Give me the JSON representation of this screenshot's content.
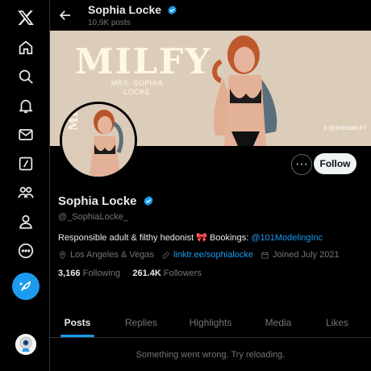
{
  "header": {
    "name": "Sophia Locke",
    "posts_count": "10,9K posts"
  },
  "banner": {
    "brand": "MILFY",
    "subtitle_line1": "MRS. SOPHIA",
    "subtitle_line2": "LOCKE",
    "handle": "X @SHESMILFY"
  },
  "profile_pic": {
    "brand": "MILFY"
  },
  "actions": {
    "follow_label": "Follow",
    "more_label": "···"
  },
  "profile": {
    "name": "Sophia Locke",
    "handle": "@_SophiaLocke_",
    "bio_text": "Responsible adult & filthy hedonist 🎀 Bookings: ",
    "bio_link": "@101ModelingInc",
    "location": "Los Angeles & Vegas",
    "website": "linktr.ee/sophialocke",
    "joined": "Joined July 2021",
    "following_count": "3,166",
    "following_label": "Following",
    "followers_count": "261.4K",
    "followers_label": "Followers"
  },
  "tabs": [
    {
      "label": "Posts",
      "active": true
    },
    {
      "label": "Replies"
    },
    {
      "label": "Highlights"
    },
    {
      "label": "Media"
    },
    {
      "label": "Likes"
    }
  ],
  "error_message": "Something went wrong. Try reloading.",
  "colors": {
    "accent": "#1d9bf0",
    "background": "#000000",
    "text": "#e7e9ea",
    "muted": "#71767b"
  },
  "sidebar": {
    "icons": [
      "x-logo-icon",
      "home-icon",
      "explore-icon",
      "notifications-icon",
      "messages-icon",
      "grok-icon",
      "communities-icon",
      "profile-icon",
      "more-icon"
    ]
  }
}
